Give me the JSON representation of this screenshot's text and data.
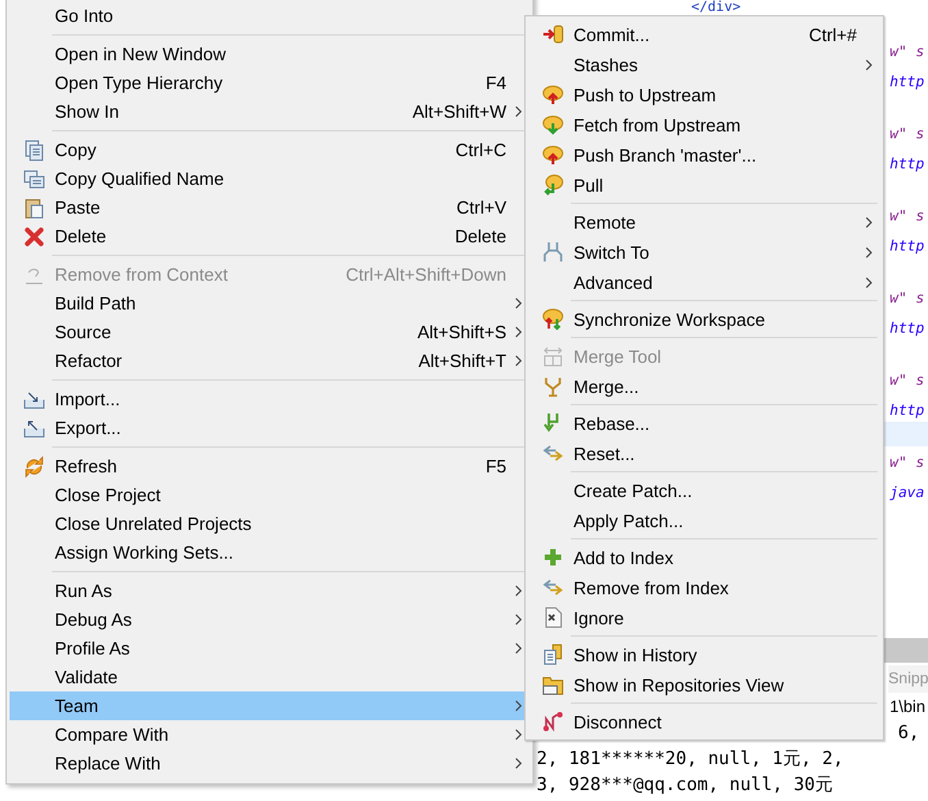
{
  "left_menu": {
    "groups": [
      [
        {
          "label": "Go Into",
          "submenu": false,
          "disabled": false,
          "selected": false
        }
      ],
      [
        {
          "label": "Open in New Window",
          "submenu": false,
          "disabled": false,
          "selected": false
        },
        {
          "label": "Open Type Hierarchy",
          "shortcut": "F4",
          "submenu": false,
          "disabled": false,
          "selected": false
        },
        {
          "label": "Show In",
          "shortcut": "Alt+Shift+W",
          "submenu": true,
          "disabled": false,
          "selected": false
        }
      ],
      [
        {
          "label": "Copy",
          "shortcut": "Ctrl+C",
          "submenu": false,
          "disabled": false,
          "selected": false
        },
        {
          "label": "Copy Qualified Name",
          "submenu": false,
          "disabled": false,
          "selected": false
        },
        {
          "label": "Paste",
          "shortcut": "Ctrl+V",
          "submenu": false,
          "disabled": false,
          "selected": false
        },
        {
          "label": "Delete",
          "shortcut": "Delete",
          "submenu": false,
          "disabled": false,
          "selected": false
        }
      ],
      [
        {
          "label": "Remove from Context",
          "shortcut": "Ctrl+Alt+Shift+Down",
          "submenu": false,
          "disabled": true,
          "selected": false
        },
        {
          "label": "Build Path",
          "submenu": true,
          "disabled": false,
          "selected": false
        },
        {
          "label": "Source",
          "shortcut": "Alt+Shift+S",
          "submenu": true,
          "disabled": false,
          "selected": false
        },
        {
          "label": "Refactor",
          "shortcut": "Alt+Shift+T",
          "submenu": true,
          "disabled": false,
          "selected": false
        }
      ],
      [
        {
          "label": "Import...",
          "submenu": false,
          "disabled": false,
          "selected": false
        },
        {
          "label": "Export...",
          "submenu": false,
          "disabled": false,
          "selected": false
        }
      ],
      [
        {
          "label": "Refresh",
          "shortcut": "F5",
          "submenu": false,
          "disabled": false,
          "selected": false
        },
        {
          "label": "Close Project",
          "submenu": false,
          "disabled": false,
          "selected": false
        },
        {
          "label": "Close Unrelated Projects",
          "submenu": false,
          "disabled": false,
          "selected": false
        },
        {
          "label": "Assign Working Sets...",
          "submenu": false,
          "disabled": false,
          "selected": false
        }
      ],
      [
        {
          "label": "Run As",
          "submenu": true,
          "disabled": false,
          "selected": false
        },
        {
          "label": "Debug As",
          "submenu": true,
          "disabled": false,
          "selected": false
        },
        {
          "label": "Profile As",
          "submenu": true,
          "disabled": false,
          "selected": false
        },
        {
          "label": "Validate",
          "submenu": false,
          "disabled": false,
          "selected": false
        },
        {
          "label": "Team",
          "submenu": true,
          "disabled": false,
          "selected": true
        },
        {
          "label": "Compare With",
          "submenu": true,
          "disabled": false,
          "selected": false
        },
        {
          "label": "Replace With",
          "submenu": true,
          "disabled": false,
          "selected": false
        }
      ]
    ]
  },
  "team_submenu": {
    "groups": [
      [
        {
          "label": "Commit...",
          "shortcut": "Ctrl+#",
          "submenu": false,
          "disabled": false
        },
        {
          "label": "Stashes",
          "submenu": true,
          "disabled": false
        },
        {
          "label": "Push to Upstream",
          "submenu": false,
          "disabled": false
        },
        {
          "label": "Fetch from Upstream",
          "submenu": false,
          "disabled": false
        },
        {
          "label": "Push Branch 'master'...",
          "submenu": false,
          "disabled": false
        },
        {
          "label": "Pull",
          "submenu": false,
          "disabled": false
        }
      ],
      [
        {
          "label": "Remote",
          "submenu": true,
          "disabled": false
        },
        {
          "label": "Switch To",
          "submenu": true,
          "disabled": false
        },
        {
          "label": "Advanced",
          "submenu": true,
          "disabled": false
        }
      ],
      [
        {
          "label": "Synchronize Workspace",
          "submenu": false,
          "disabled": false
        }
      ],
      [
        {
          "label": "Merge Tool",
          "submenu": false,
          "disabled": true
        },
        {
          "label": "Merge...",
          "submenu": false,
          "disabled": false
        }
      ],
      [
        {
          "label": "Rebase...",
          "submenu": false,
          "disabled": false
        },
        {
          "label": "Reset...",
          "submenu": false,
          "disabled": false
        }
      ],
      [
        {
          "label": "Create Patch...",
          "submenu": false,
          "disabled": false
        },
        {
          "label": "Apply Patch...",
          "submenu": false,
          "disabled": false
        }
      ],
      [
        {
          "label": "Add to Index",
          "submenu": false,
          "disabled": false
        },
        {
          "label": "Remove from Index",
          "submenu": false,
          "disabled": false
        },
        {
          "label": "Ignore",
          "submenu": false,
          "disabled": false
        }
      ],
      [
        {
          "label": "Show in History",
          "submenu": false,
          "disabled": false
        },
        {
          "label": "Show in Repositories View",
          "submenu": false,
          "disabled": false
        }
      ],
      [
        {
          "label": "Disconnect",
          "submenu": false,
          "disabled": false
        }
      ]
    ]
  },
  "editor": {
    "top_line": "</div>",
    "fragments": [
      [
        "w\" s",
        "http"
      ],
      [
        "w\" s",
        "http"
      ],
      [
        "w\" s",
        "http"
      ],
      [
        "w\" s",
        "http"
      ],
      [
        "w\" s",
        "http"
      ],
      [
        "w\" s",
        "java"
      ]
    ]
  },
  "bottom_panel": {
    "tab": "Snipp",
    "path": "1\\bin",
    "console_lines": [
      "6,",
      "2, 181******20, null, 1元, 2,",
      "3, 928***@qq.com, null, 30元"
    ]
  }
}
